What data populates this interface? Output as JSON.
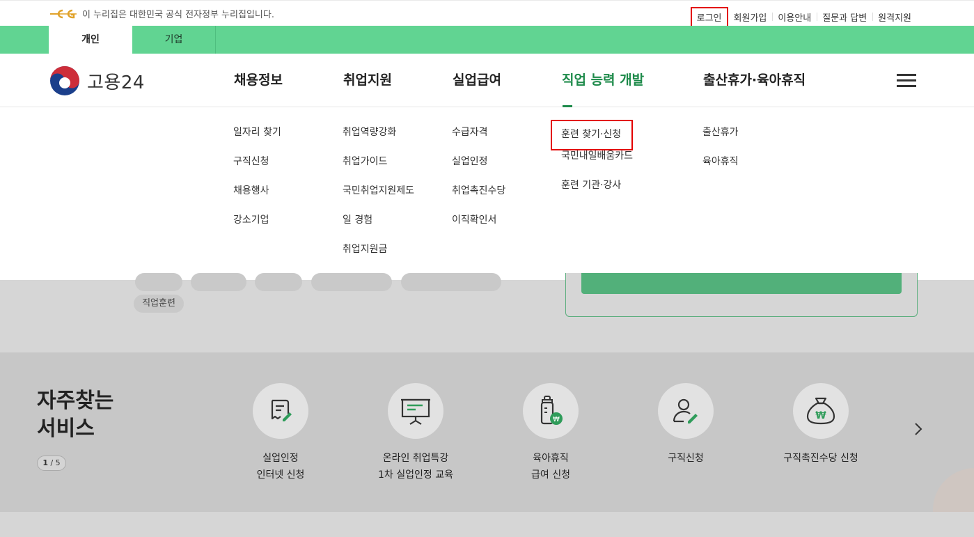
{
  "util_bar": {
    "gov_notice": "이 누리집은 대한민국 공식 전자정부 누리집입니다.",
    "links": [
      "로그인",
      "회원가입",
      "이용안내",
      "질문과 답변",
      "원격지원"
    ]
  },
  "tabs": [
    "개인",
    "기업"
  ],
  "brand": {
    "name": "고용24"
  },
  "gnb": [
    "채용정보",
    "취업지원",
    "실업급여",
    "직업 능력 개발",
    "출산휴가·육아휴직"
  ],
  "mega_menu": {
    "col1": [
      "일자리 찾기",
      "구직신청",
      "채용행사",
      "강소기업"
    ],
    "col2": [
      "취업역량강화",
      "취업가이드",
      "국민취업지원제도",
      "일 경험",
      "취업지원금"
    ],
    "col3": [
      "수급자격",
      "실업인정",
      "취업촉진수당",
      "이직확인서"
    ],
    "col4": [
      "훈련 찾기·신청",
      "국민내일배움카드",
      "훈련 기관·강사"
    ],
    "col5": [
      "출산휴가",
      "육아휴직"
    ]
  },
  "keyword_tag": "직업훈련",
  "services": {
    "title_line1": "자주찾는",
    "title_line2": "서비스",
    "page_current": "1",
    "page_total": "5",
    "items": [
      {
        "line1": "실업인정",
        "line2": "인터넷 신청",
        "icon": "document-pen-icon"
      },
      {
        "line1": "온라인 취업특강",
        "line2": "1차 실업인정 교육",
        "icon": "presentation-board-icon"
      },
      {
        "line1": "육아휴직",
        "line2": "급여 신청",
        "icon": "baby-bottle-won-icon"
      },
      {
        "line1": "구직신청",
        "line2": "",
        "icon": "person-pen-icon"
      },
      {
        "line1": "구직촉진수당 신청",
        "line2": "",
        "icon": "money-bag-won-icon"
      }
    ]
  },
  "colors": {
    "green_bar": "#61d492",
    "active_menu": "#1d8a4a",
    "highlight_box": "#e30000"
  }
}
